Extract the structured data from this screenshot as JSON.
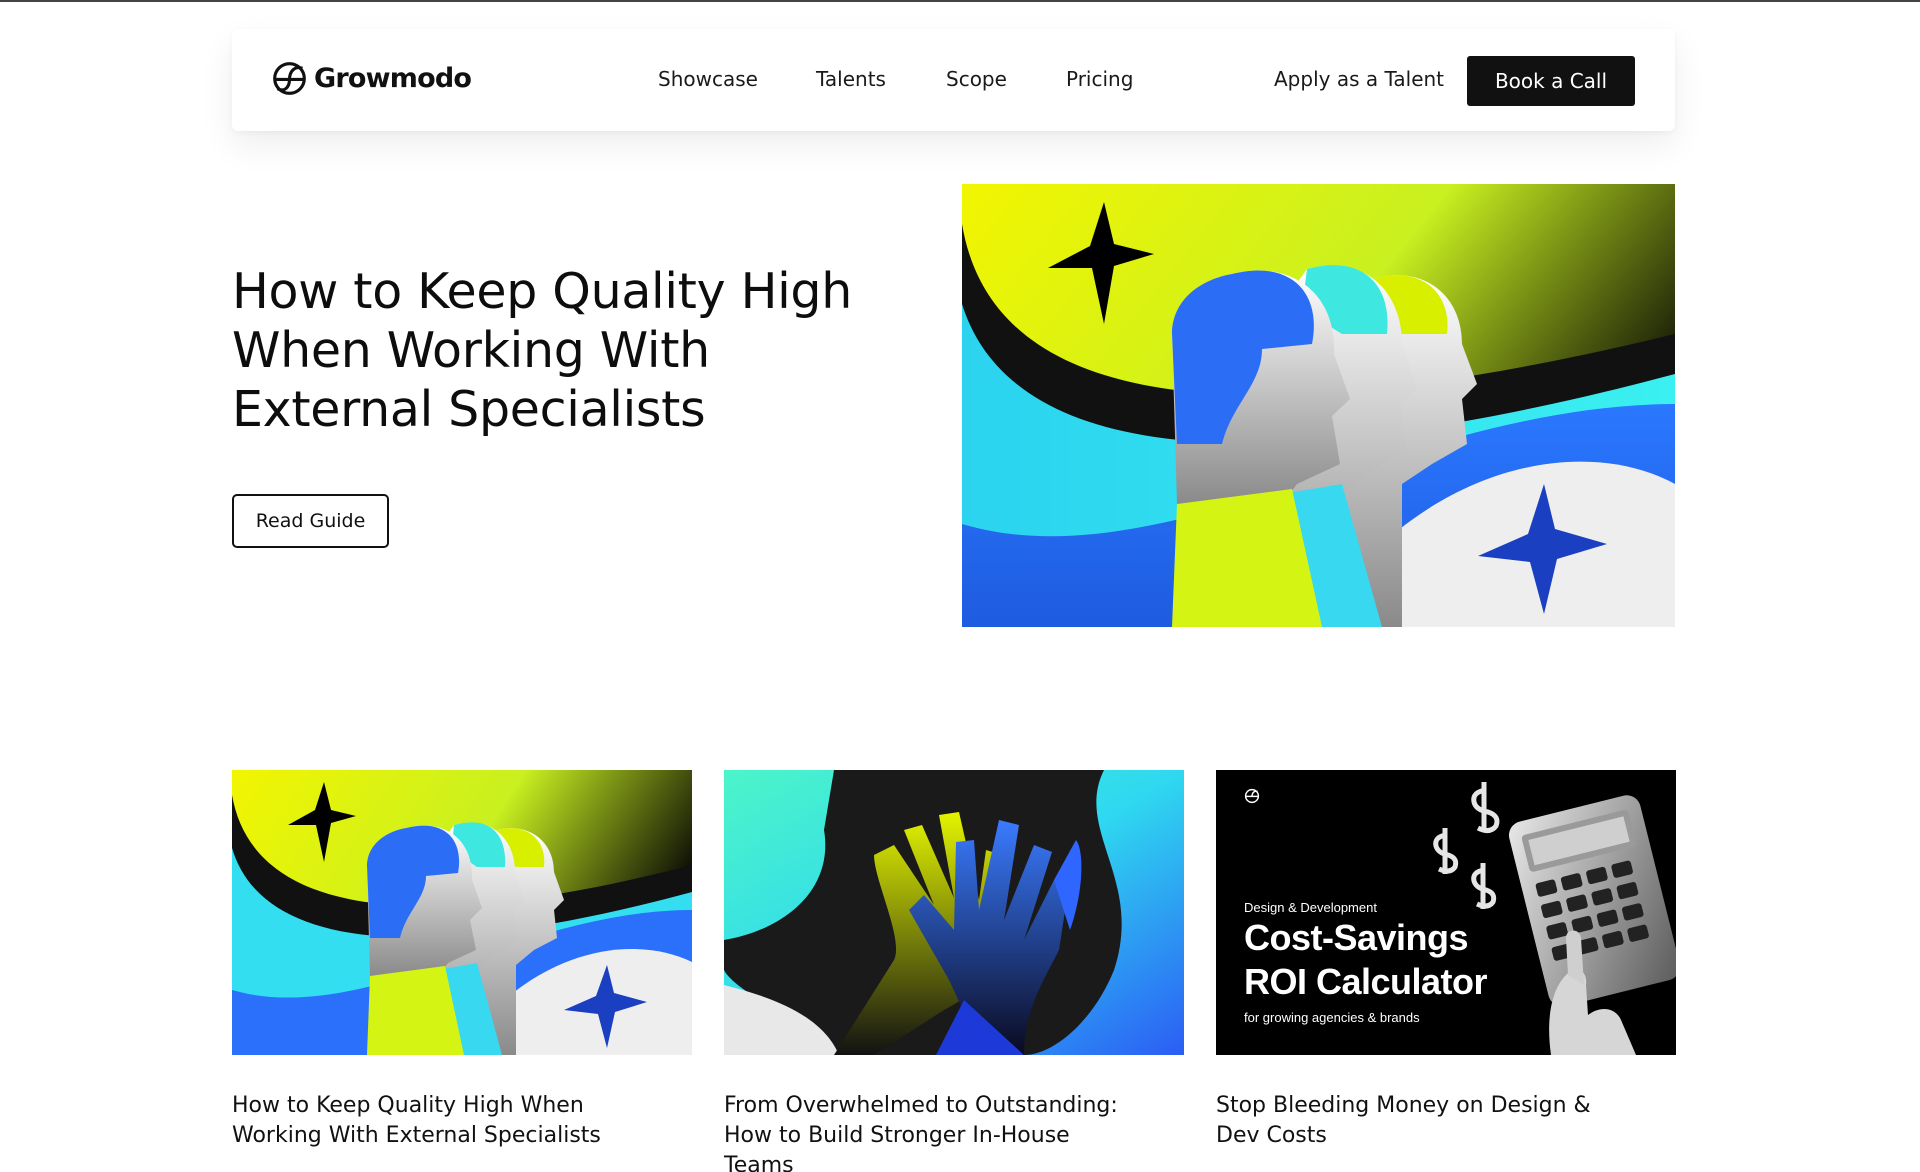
{
  "header": {
    "logo_text": "Growmodo",
    "nav": [
      "Showcase",
      "Talents",
      "Scope",
      "Pricing"
    ],
    "apply_label": "Apply as a Talent",
    "book_label": "Book a Call"
  },
  "hero": {
    "title": "How to Keep Quality High When Working With External Specialists",
    "button_label": "Read Guide",
    "image_icon": "illustration-three-heads"
  },
  "cards": [
    {
      "title": "How to Keep Quality High When Working With External Specialists",
      "image_icon": "illustration-three-heads"
    },
    {
      "title": "From Overwhelmed to Outstanding: How to Build Stronger In-House Teams",
      "image_icon": "illustration-high-five-hands"
    },
    {
      "title": "Stop Bleeding Money on Design & Dev Costs",
      "image_icon": "illustration-calculator",
      "image_eyebrow": "Design & Development",
      "image_heading_line1": "Cost-Savings",
      "image_heading_line2": "ROI Calculator",
      "image_subline": "for growing agencies & brands"
    }
  ],
  "colors": {
    "ink": "#111111",
    "yellow": "#e8f500",
    "cyan": "#38e6e6",
    "blue": "#2f66ff",
    "black": "#0a0a0a"
  }
}
